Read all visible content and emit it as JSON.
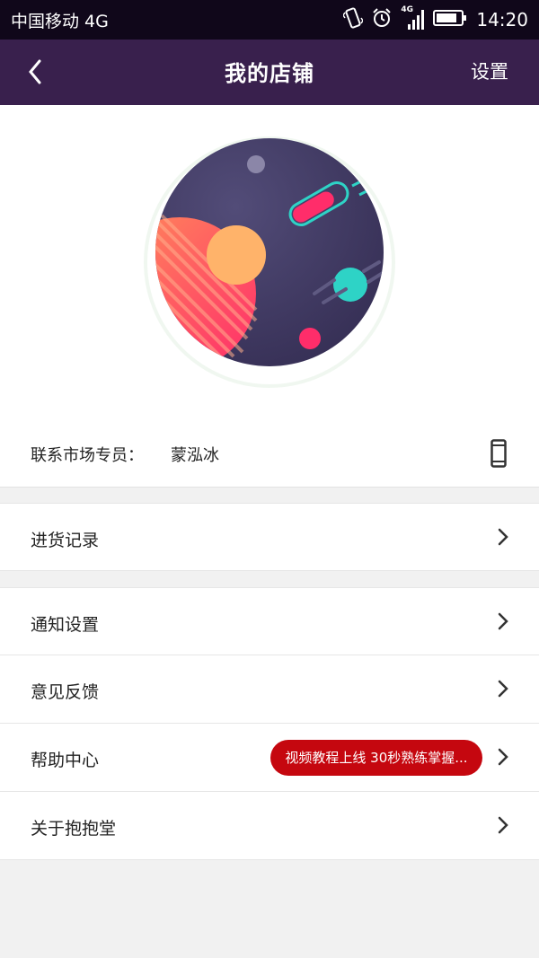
{
  "status_bar": {
    "carrier": "中国移动 4G",
    "network_badge": "4G",
    "time": "14:20",
    "icons": [
      "vibrate-icon",
      "alarm-icon",
      "signal-icon",
      "battery-icon"
    ]
  },
  "nav": {
    "title": "我的店铺",
    "settings_label": "设置",
    "back_icon": "chevron-left-icon",
    "background": "#39204d"
  },
  "contact": {
    "label": "联系市场专员：",
    "name": "蒙泓冰",
    "phone_icon": "phone-icon"
  },
  "menu": {
    "purchase_records": "进货记录",
    "notification_settings": "通知设置",
    "feedback": "意见反馈",
    "help_center": "帮助中心",
    "help_badge": "视频教程上线 30秒熟练掌握...",
    "about": "关于抱抱堂"
  },
  "colors": {
    "accent": "#39204d",
    "badge": "#c5070f",
    "background": "#f1f1f1"
  }
}
